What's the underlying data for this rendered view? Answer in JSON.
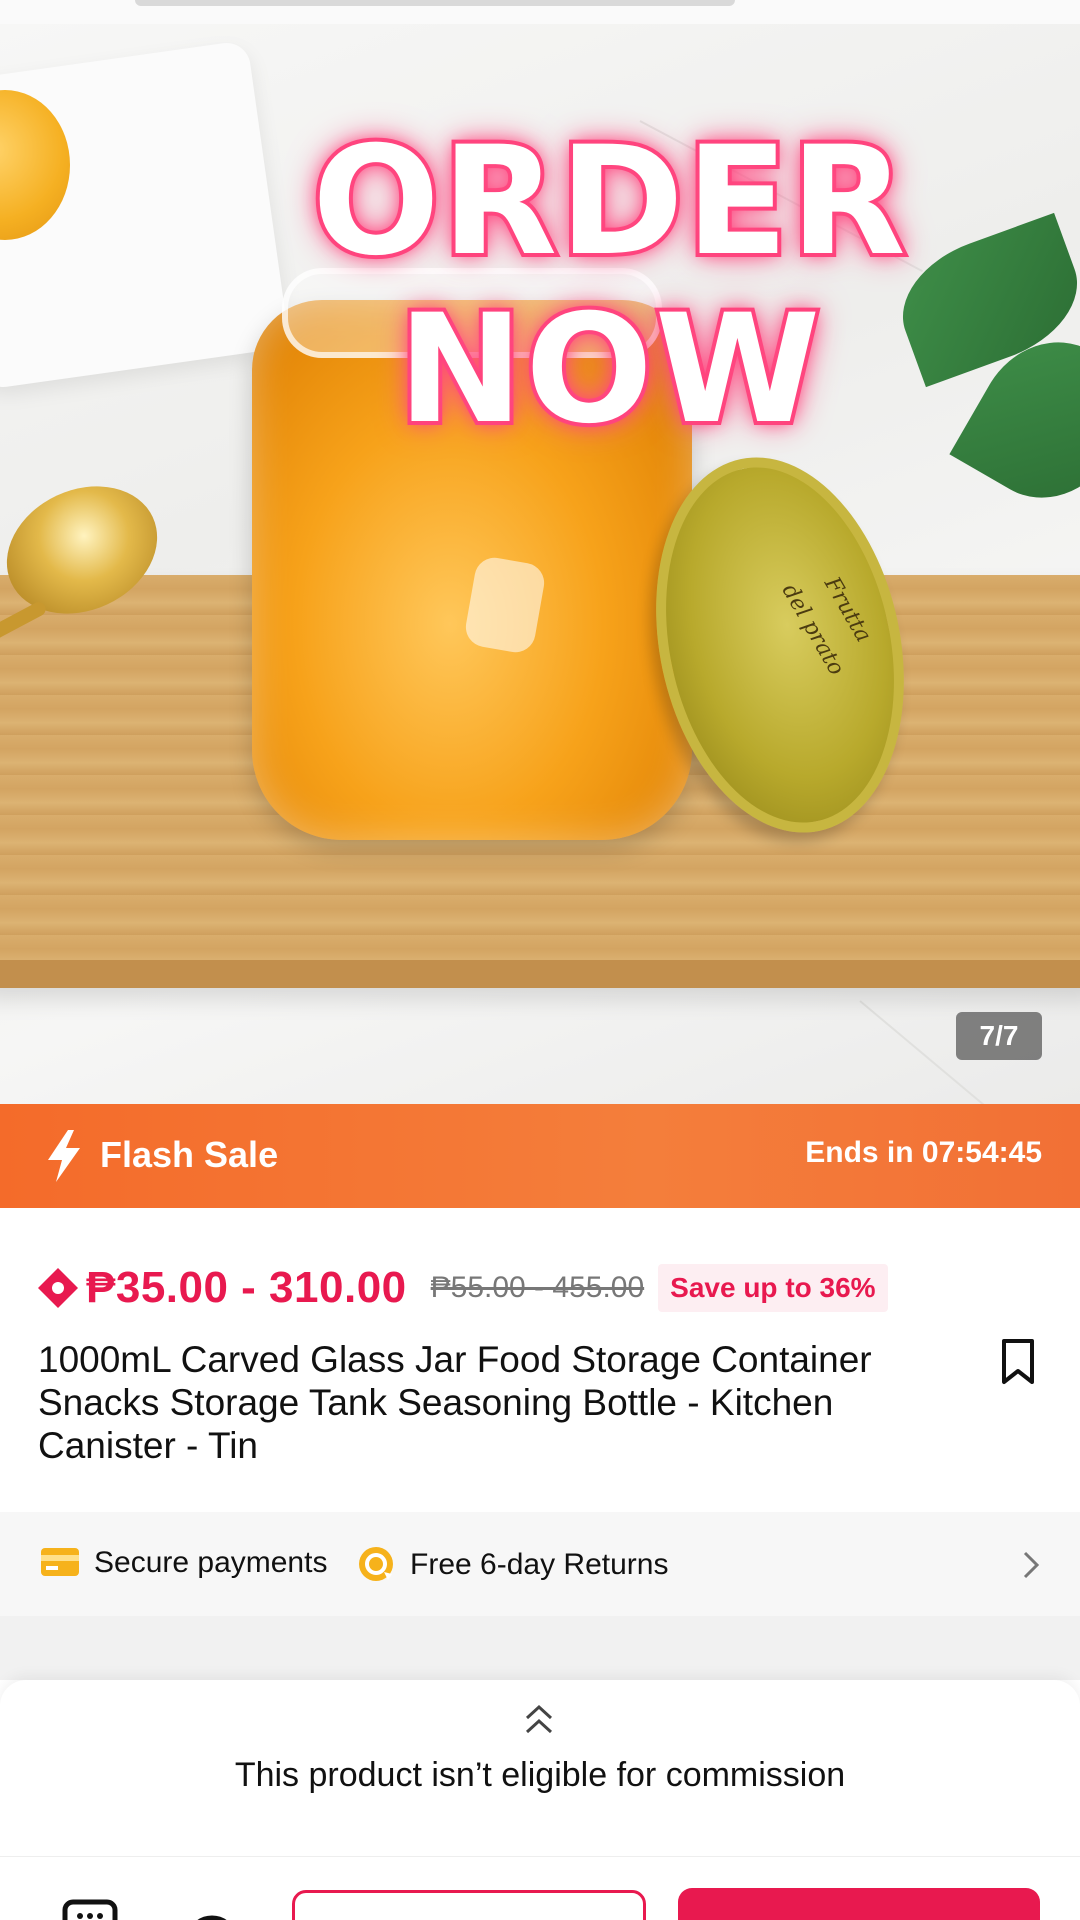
{
  "hero": {
    "overlay_line1": "ORDER",
    "overlay_line2": "NOW",
    "image_counter": "7/7",
    "lid_text_1": "Frutta",
    "lid_text_2": "del prato"
  },
  "flash_sale": {
    "label": "Flash Sale",
    "ends_in": "Ends in 07:54:45",
    "icon": "lightning-icon"
  },
  "product": {
    "price_range": "₱35.00 - 310.00",
    "original_price": "₱55.00 - 455.00",
    "save_badge": "Save up to 36%",
    "title": "1000mL Carved Glass Jar Food Storage Container Snacks Storage Tank Seasoning Bottle - Kitchen Canister - Tin",
    "price_icon": "coupon-diamond-icon",
    "bookmark_icon": "bookmark-icon"
  },
  "services": {
    "secure_payments": "Secure payments",
    "free_returns": "Free 6-day Returns",
    "card_icon": "card-icon",
    "returns_icon": "returns-icon",
    "chevron_icon": "chevron-right-icon"
  },
  "commission_panel": {
    "text": "This product isn’t eligible for commission",
    "expand_icon": "double-chevron-up-icon"
  },
  "colors": {
    "brand_pink": "#e8194f",
    "flash_orange": "#f46b2a",
    "neon_pink": "#ff3f7a"
  }
}
